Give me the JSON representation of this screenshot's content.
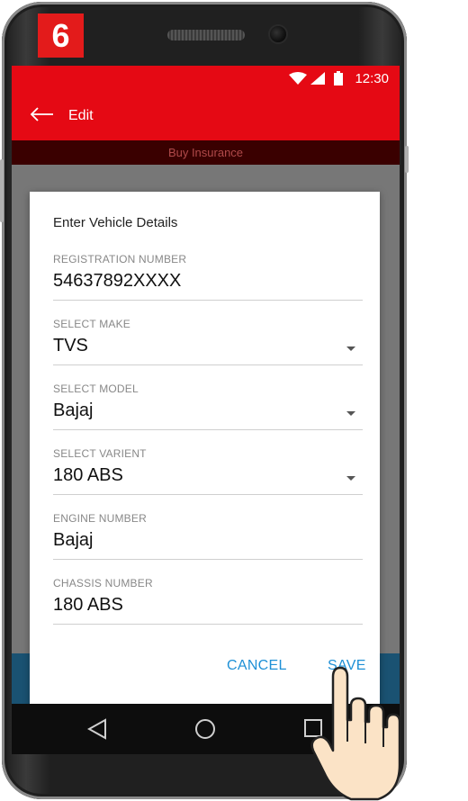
{
  "step_badge": "6",
  "status_bar": {
    "time": "12:30",
    "icons": [
      "wifi-icon",
      "signal-icon",
      "battery-icon"
    ]
  },
  "app_bar": {
    "back_icon": "arrow-left-icon",
    "title": "Edit"
  },
  "sub_bar": {
    "label": "Buy Insurance"
  },
  "dialog": {
    "title": "Enter Vehicle Details",
    "fields": [
      {
        "label": "REGISTRATION NUMBER",
        "value": "54637892XXXX",
        "dropdown": false
      },
      {
        "label": "SELECT MAKE",
        "value": "TVS",
        "dropdown": true
      },
      {
        "label": "SELECT MODEL",
        "value": "Bajaj",
        "dropdown": true
      },
      {
        "label": "SELECT VARIENT",
        "value": "180 ABS",
        "dropdown": true
      },
      {
        "label": "ENGINE NUMBER",
        "value": "Bajaj",
        "dropdown": false
      },
      {
        "label": "CHASSIS NUMBER",
        "value": "180 ABS",
        "dropdown": false
      }
    ],
    "cancel_label": "CANCEL",
    "save_label": "SAVE"
  },
  "nav_bar": {
    "icons": [
      "back-triangle-icon",
      "home-circle-icon",
      "recents-square-icon"
    ]
  },
  "colors": {
    "primary": "#e50914",
    "accent": "#1e90d6",
    "badge": "#e31b1b"
  }
}
